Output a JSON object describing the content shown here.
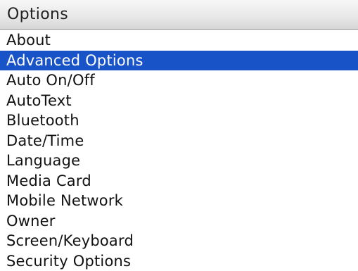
{
  "screen": {
    "title": "Options"
  },
  "menu": {
    "items": [
      {
        "label": "About"
      },
      {
        "label": "Advanced Options"
      },
      {
        "label": "Auto On/Off"
      },
      {
        "label": "AutoText"
      },
      {
        "label": "Bluetooth"
      },
      {
        "label": "Date/Time"
      },
      {
        "label": "Language"
      },
      {
        "label": "Media Card"
      },
      {
        "label": "Mobile Network"
      },
      {
        "label": "Owner"
      },
      {
        "label": "Screen/Keyboard"
      },
      {
        "label": "Security Options"
      }
    ],
    "selected_label": "Advanced Options"
  },
  "colors": {
    "selection_bg": "#1853c7",
    "selection_text": "#ffffff",
    "title_bar": "#e6e6e6"
  }
}
